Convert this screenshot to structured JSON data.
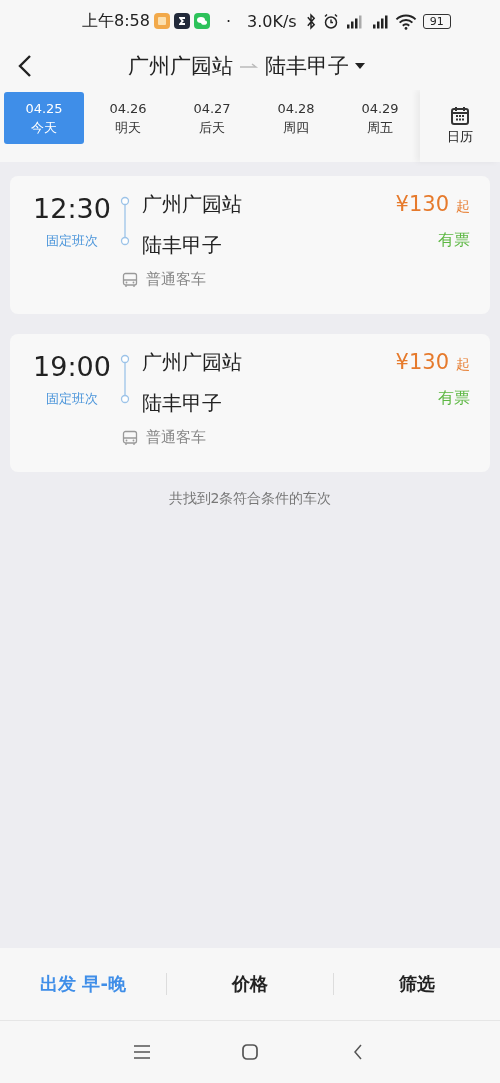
{
  "status_bar": {
    "time": "上午8:58",
    "dot": "·",
    "speed": "3.0K/s",
    "battery": "91"
  },
  "header": {
    "from": "广州广园站",
    "to": "陆丰甲子"
  },
  "dates": [
    {
      "date": "04.25",
      "day": "今天",
      "selected": true
    },
    {
      "date": "04.26",
      "day": "明天",
      "selected": false
    },
    {
      "date": "04.27",
      "day": "后天",
      "selected": false
    },
    {
      "date": "04.28",
      "day": "周四",
      "selected": false
    },
    {
      "date": "04.29",
      "day": "周五",
      "selected": false
    }
  ],
  "calendar": {
    "label": "日历"
  },
  "trips": [
    {
      "time": "12:30",
      "type": "固定班次",
      "from": "广州广园站",
      "to": "陆丰甲子",
      "price": "¥130",
      "price_suffix": "起",
      "availability": "有票",
      "bus": "普通客车"
    },
    {
      "time": "19:00",
      "type": "固定班次",
      "from": "广州广园站",
      "to": "陆丰甲子",
      "price": "¥130",
      "price_suffix": "起",
      "availability": "有票",
      "bus": "普通客车"
    }
  ],
  "summary": "共找到2条符合条件的车次",
  "filters": [
    {
      "label": "出发 早-晚",
      "selected": true
    },
    {
      "label": "价格",
      "selected": false
    },
    {
      "label": "筛选",
      "selected": false
    }
  ]
}
